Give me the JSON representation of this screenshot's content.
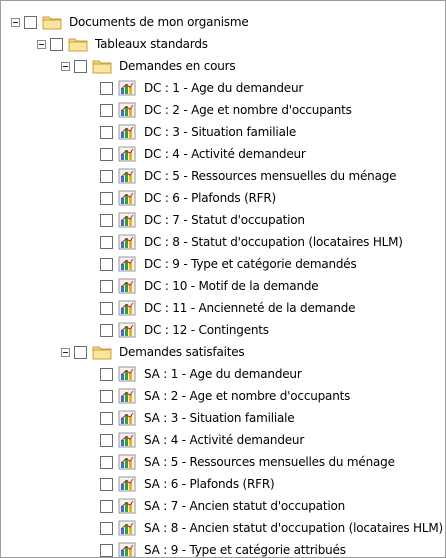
{
  "tree": {
    "root": "Documents de mon organisme",
    "standard": "Tableaux standards",
    "dc_group": "Demandes en cours",
    "dc_items": [
      "DC : 1 - Age du demandeur",
      "DC : 2 - Age et nombre d'occupants",
      "DC : 3 - Situation familiale",
      "DC : 4 - Activité demandeur",
      "DC : 5 - Ressources mensuelles du ménage",
      "DC : 6 - Plafonds (RFR)",
      "DC : 7 - Statut d'occupation",
      "DC : 8 - Statut d'occupation (locataires HLM)",
      "DC : 9 - Type et catégorie demandés",
      "DC : 10 - Motif de la demande",
      "DC : 11 - Ancienneté de la demande",
      "DC : 12 - Contingents"
    ],
    "sa_group": "Demandes satisfaites",
    "sa_items": [
      "SA : 1 - Age du demandeur",
      "SA : 2 - Age et nombre d'occupants",
      "SA : 3 - Situation familiale",
      "SA : 4 - Activité demandeur",
      "SA : 5 - Ressources mensuelles du ménage",
      "SA : 6 - Plafonds (RFR)",
      "SA : 7 - Ancien statut d'occupation",
      "SA : 8 - Ancien statut d'occupation (locataires HLM)",
      "SA : 9 - Type et catégorie attribués"
    ]
  },
  "icons": {
    "folder": "folder-icon",
    "report": "chart-report-icon",
    "expander": "collapse-minus-icon"
  },
  "colors": {
    "folder_fill": "#f7d87c",
    "folder_edge": "#c9a23d",
    "bar_blue": "#3b6fd1",
    "bar_green": "#3a9e3a",
    "bar_yellow": "#e5b51c"
  }
}
